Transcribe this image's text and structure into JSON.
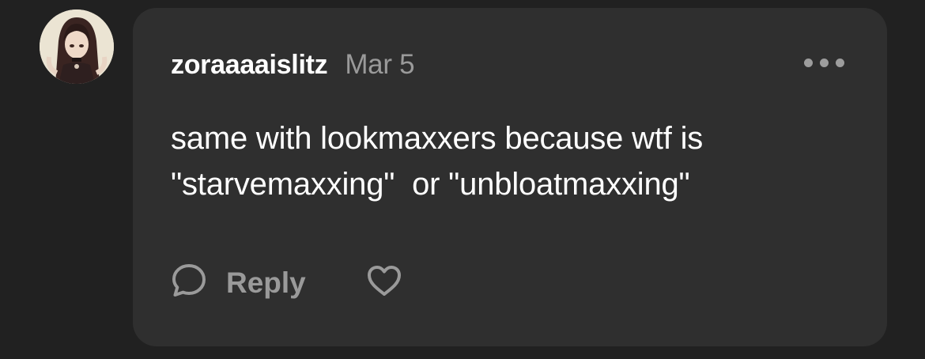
{
  "comment": {
    "username": "zoraaaaislitz",
    "date": "Mar 5",
    "text": "same with lookmaxxers because wtf is\n\"starvemaxxing\"  or \"unbloatmaxxing\"",
    "reply_label": "Reply"
  },
  "icons": {
    "more": "more-options-icon",
    "reply": "speech-bubble-icon",
    "like": "heart-icon"
  },
  "colors": {
    "background": "#212121",
    "card": "#2f2f2f",
    "text_primary": "#ffffff",
    "text_secondary": "#9a9a9a"
  }
}
